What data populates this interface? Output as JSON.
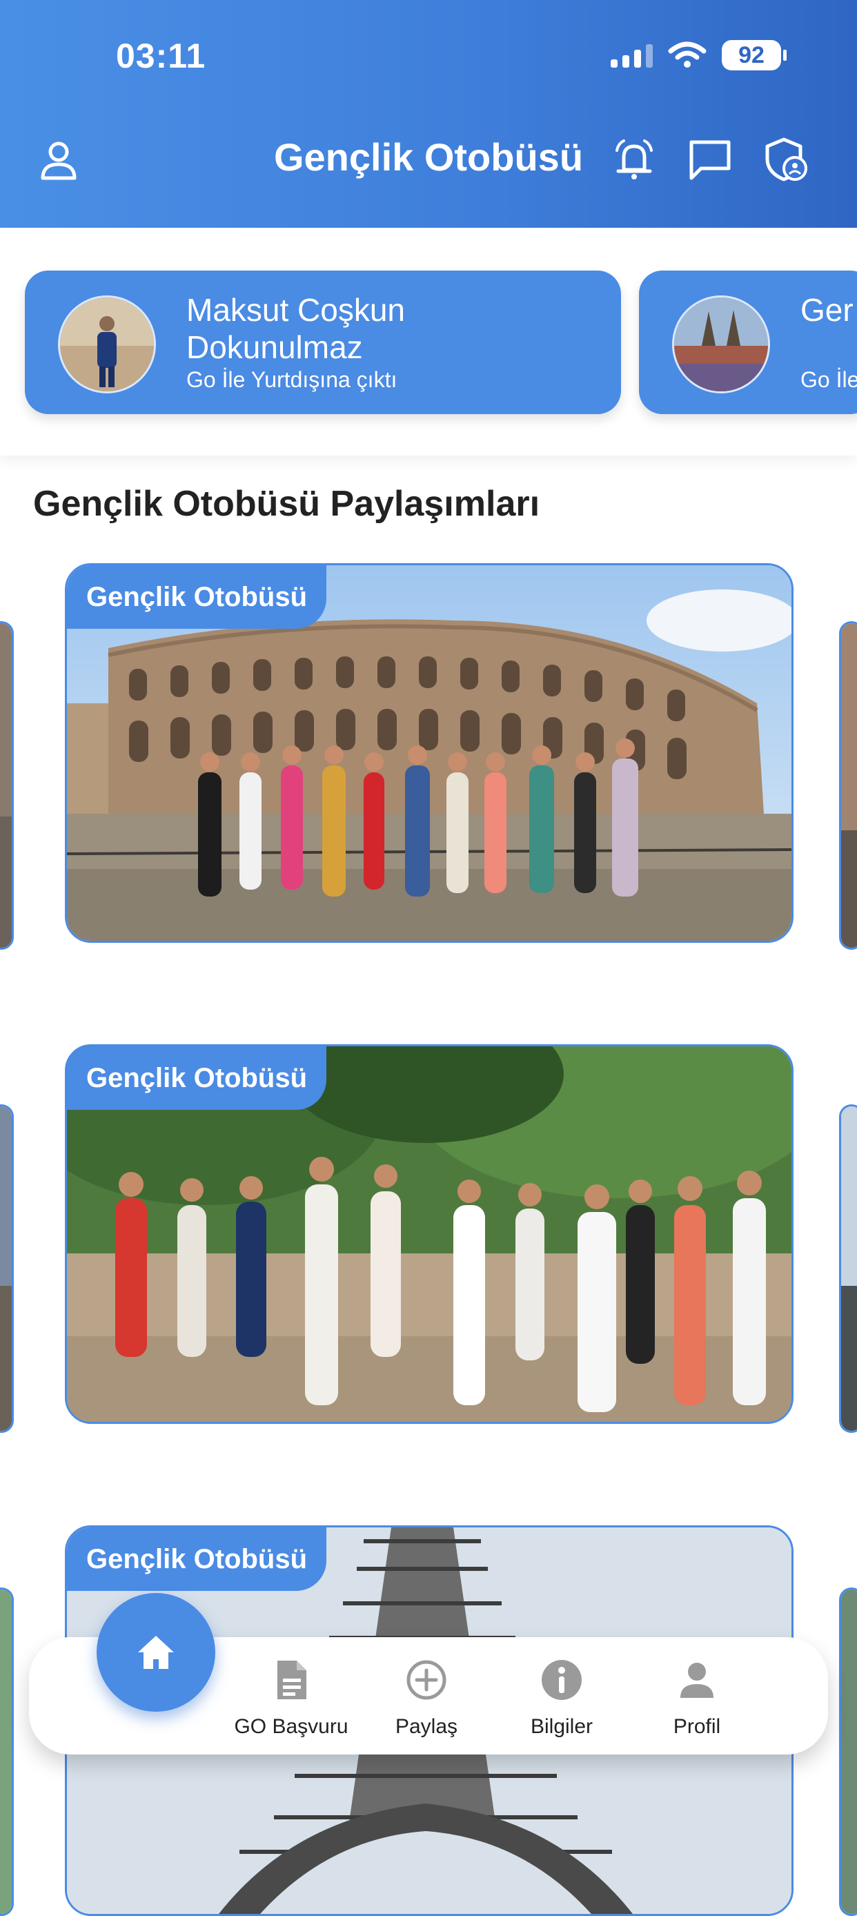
{
  "status_bar": {
    "time": "03:11",
    "battery": "92"
  },
  "header": {
    "title": "Gençlik Otobüsü"
  },
  "stories": [
    {
      "name": "Maksut Coşkun Dokunulmaz",
      "subtitle": "Go İle Yurtdışına çıktı"
    },
    {
      "name": "Ger",
      "subtitle": "Go İle"
    }
  ],
  "feed": {
    "title": "Gençlik Otobüsü Paylaşımları",
    "posts": [
      {
        "label": "Gençlik Otobüsü"
      },
      {
        "label": "Gençlik Otobüsü"
      },
      {
        "label": "Gençlik Otobüsü"
      }
    ]
  },
  "bottom_nav": {
    "items": [
      {
        "label": "GO Başvuru",
        "icon": "document-icon"
      },
      {
        "label": "Paylaş",
        "icon": "plus-circle-icon"
      },
      {
        "label": "Bilgiler",
        "icon": "info-icon"
      },
      {
        "label": "Profil",
        "icon": "person-icon"
      }
    ]
  },
  "colors": {
    "primary": "#4a8be4",
    "header_dark": "#2f66c4"
  }
}
